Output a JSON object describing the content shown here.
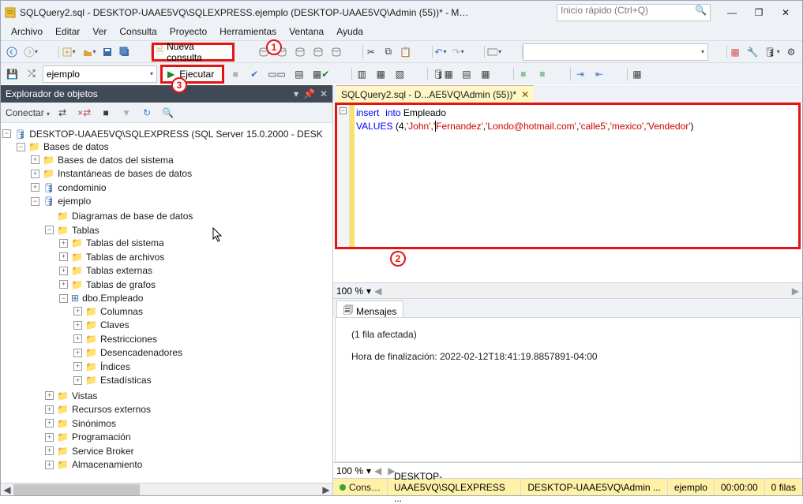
{
  "window": {
    "title": "SQLQuery2.sql - DESKTOP-UAAE5VQ\\SQLEXPRESS.ejemplo (DESKTOP-UAAE5VQ\\Admin (55))* - Microsoft SQL Server Manage...",
    "quick_placeholder": "Inicio rápido (Ctrl+Q)"
  },
  "menu": {
    "m0": "Archivo",
    "m1": "Editar",
    "m2": "Ver",
    "m3": "Consulta",
    "m4": "Proyecto",
    "m5": "Herramientas",
    "m6": "Ventana",
    "m7": "Ayuda"
  },
  "toolbar": {
    "nueva_consulta": "Nueva consulta",
    "db_combo": "ejemplo",
    "ejecutar": "Ejecutar"
  },
  "annotations": {
    "n1": "1",
    "n2": "2",
    "n3": "3"
  },
  "explorer": {
    "title": "Explorador de objetos",
    "conectar": "Conectar",
    "server": "DESKTOP-UAAE5VQ\\SQLEXPRESS (SQL Server 15.0.2000 - DESK",
    "n_bases": "Bases de datos",
    "n_bds": "Bases de datos del sistema",
    "n_inst": "Instantáneas de bases de datos",
    "n_condo": "condominio",
    "n_ejemplo": "ejemplo",
    "n_diag": "Diagramas de base de datos",
    "n_tablas": "Tablas",
    "n_tsis": "Tablas del sistema",
    "n_tarc": "Tablas de archivos",
    "n_text": "Tablas externas",
    "n_tgra": "Tablas de grafos",
    "n_emp": "dbo.Empleado",
    "n_col": "Columnas",
    "n_cla": "Claves",
    "n_res": "Restricciones",
    "n_des": "Desencadenadores",
    "n_ind": "Índices",
    "n_est": "Estadísticas",
    "n_vis": "Vistas",
    "n_rec": "Recursos externos",
    "n_sin": "Sinónimos",
    "n_pro": "Programación",
    "n_sb": "Service Broker",
    "n_alm": "Almacenamiento"
  },
  "editor": {
    "tab_label": "SQLQuery2.sql - D...AE5VQ\\Admin (55))*",
    "kw_insert": "insert",
    "kw_into": "into",
    "tbl": " Empleado",
    "nl": "\n",
    "kw_values": "VALUES ",
    "lp": "(",
    "n4": "4",
    "c": ",",
    "q": "'",
    "s_john": "John",
    "s_fern": "Fernandez",
    "s_mail": "Londo@hotmail.com",
    "s_calle": "calle5",
    "s_mex": "mexico",
    "s_vend": "Vendedor",
    "rp": ")"
  },
  "zoom": {
    "pct": "100 %",
    "dd": "▾"
  },
  "messages": {
    "tab": "Mensajes",
    "line1": "(1 fila afectada)",
    "line2": "Hora de finalización: 2022-02-12T18:41:19.8857891-04:00"
  },
  "status": {
    "ok": "Cons…",
    "s1": "DESKTOP-UAAE5VQ\\SQLEXPRESS ...",
    "s2": "DESKTOP-UAAE5VQ\\Admin ...",
    "s3": "ejemplo",
    "s4": "00:00:00",
    "s5": "0 filas"
  }
}
